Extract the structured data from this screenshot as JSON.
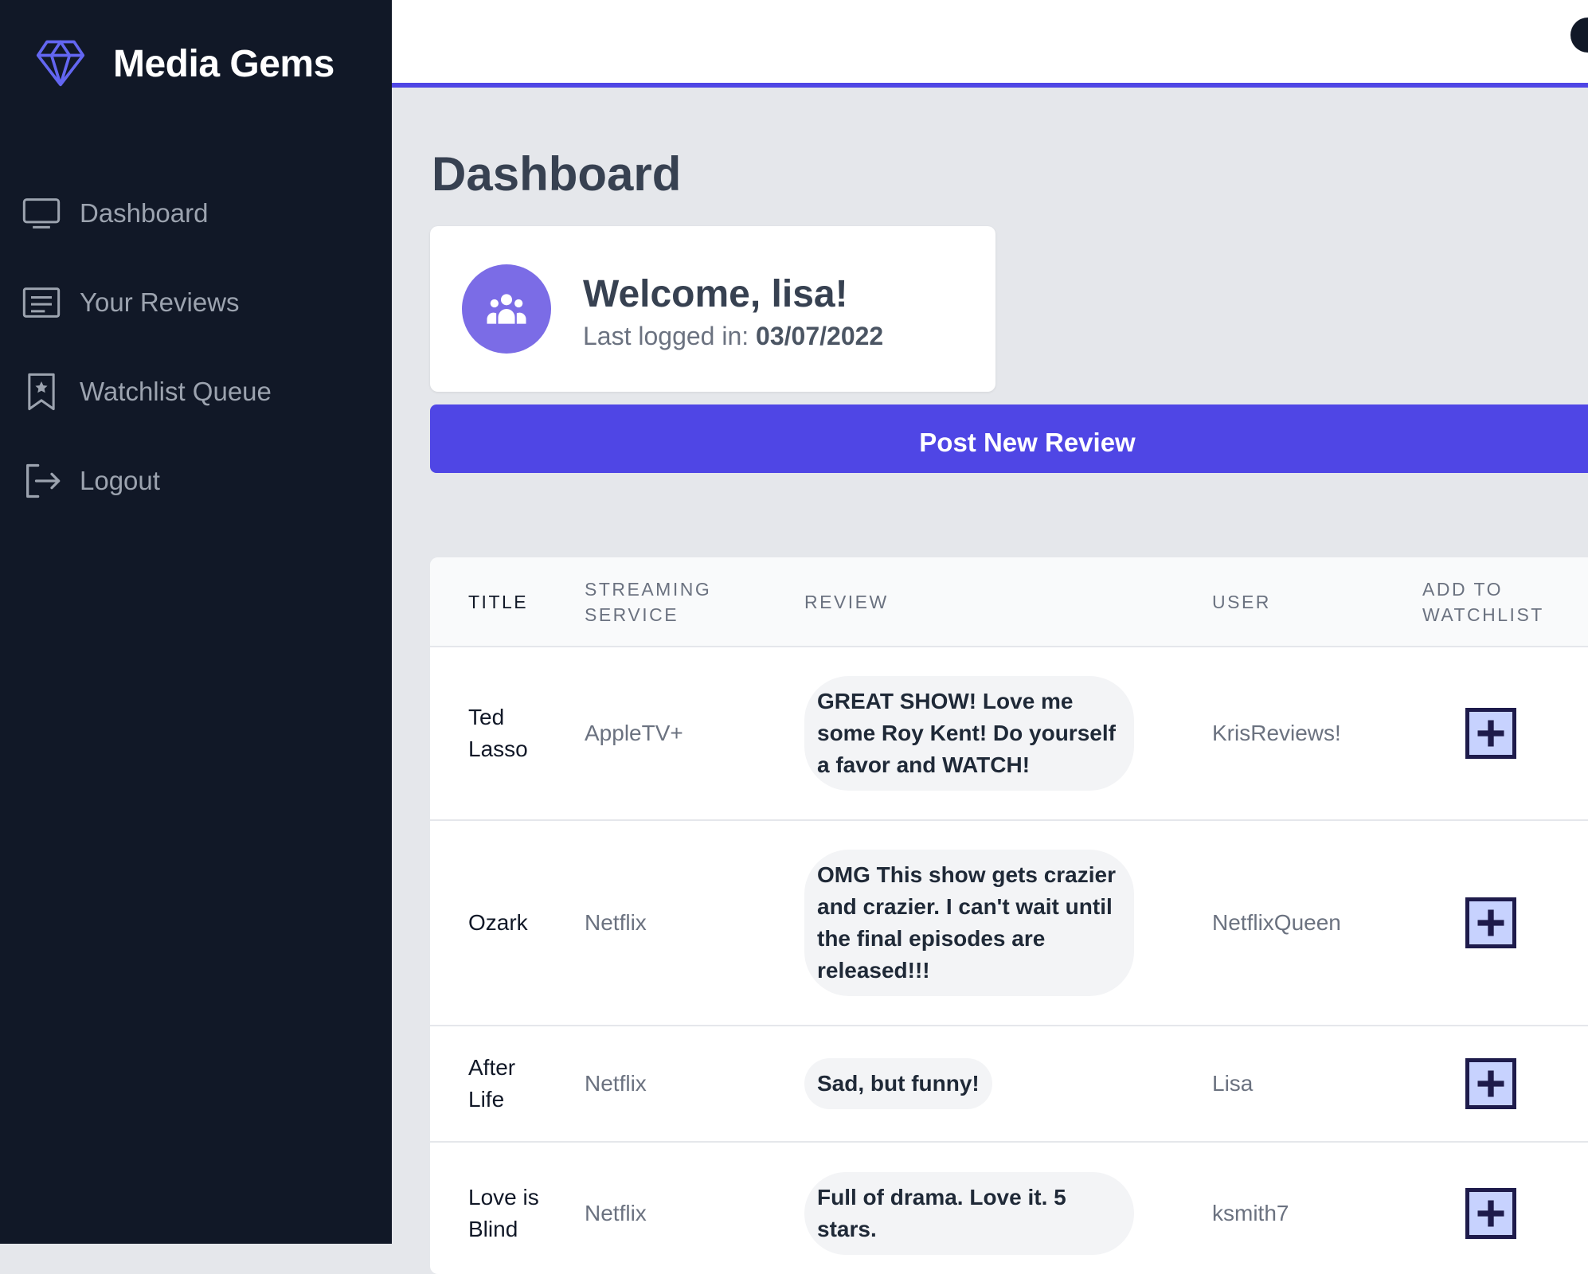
{
  "app": {
    "name": "Media Gems",
    "logo_icon": "gem-icon",
    "accent_color": "#4f46e5",
    "sidebar_color": "#111827"
  },
  "sidebar": {
    "items": [
      {
        "label": "Dashboard",
        "icon": "monitor-icon"
      },
      {
        "label": "Your Reviews",
        "icon": "document-list-icon"
      },
      {
        "label": "Watchlist Queue",
        "icon": "bookmark-star-icon"
      },
      {
        "label": "Logout",
        "icon": "logout-icon"
      }
    ]
  },
  "main": {
    "page_title": "Dashboard",
    "welcome": {
      "title": "Welcome, lisa!",
      "last_logged_label": "Last logged in: ",
      "last_logged_date": "03/07/2022",
      "icon": "user-group-icon"
    },
    "post_button_label": "Post New Review"
  },
  "table": {
    "headers": {
      "title": "Title",
      "streaming_service": "Streaming Service",
      "review": "Review",
      "user": "User",
      "add_to_watchlist": "Add to Watchlist"
    },
    "rows": [
      {
        "title": "Ted Lasso",
        "service": "AppleTV+",
        "review": "GREAT SHOW! Love me some Roy Kent! Do yourself a favor and WATCH!",
        "user": "KrisReviews!"
      },
      {
        "title": "Ozark",
        "service": "Netflix",
        "review": "OMG This show gets crazier and crazier. I can't wait until the final episodes are released!!!",
        "user": "NetflixQueen"
      },
      {
        "title": "After Life",
        "service": "Netflix",
        "review": "Sad, but funny!",
        "user": "Lisa"
      },
      {
        "title": "Love is Blind",
        "service": "Netflix",
        "review": "Full of drama. Love it. 5 stars.",
        "user": "ksmith7"
      }
    ],
    "add_icon": "plus-icon"
  }
}
